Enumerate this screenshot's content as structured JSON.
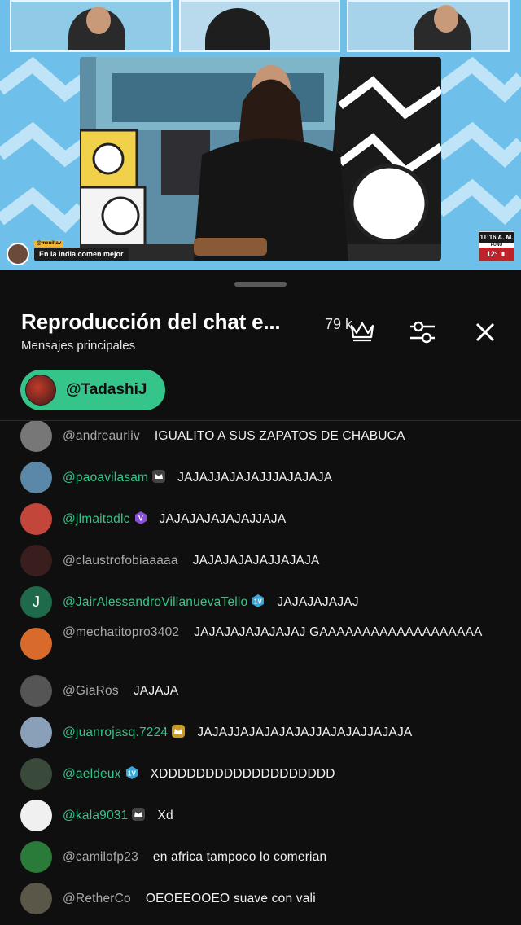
{
  "video": {
    "caption_handle": "@meniltav",
    "caption_text": "En la India comen mejor",
    "clock_time": "11:16 A. M.",
    "clock_city": "PUNO",
    "clock_temp": "12°"
  },
  "chat": {
    "title": "Reproducción del chat e...",
    "subtitle": "Mensajes principales",
    "viewers": "79 k",
    "pinned_user": "@TadashiJ",
    "messages": [
      {
        "author": "@andreaurliv",
        "text": "IGUALITO A SUS ZAPATOS DE CHABUCA",
        "green": false,
        "badge": "",
        "avatar_color": "#777777"
      },
      {
        "author": "@paoavilasam",
        "text": "JAJAJJAJAJAJJJAJAJAJA",
        "green": true,
        "badge": "crown-badge",
        "avatar_color": "#5b87a8"
      },
      {
        "author": "@jlmaitadlc",
        "text": "JAJAJAJAJAJAJJAJA",
        "green": true,
        "badge": "member-badge-purple",
        "avatar_color": "#c2473a"
      },
      {
        "author": "@claustrofobiaaaaa",
        "text": "JAJAJAJAJAJJAJAJA",
        "green": false,
        "badge": "",
        "avatar_color": "#3a1e1e"
      },
      {
        "author": "@JairAlessandroVillanuevaTello",
        "text": "JAJAJAJAJAJ",
        "green": true,
        "badge": "member-badge-1v",
        "avatar_color": "#1f6a4a",
        "initial": "J"
      },
      {
        "author": "@mechatitopro3402",
        "text": "JAJAJAJAJAJAJAJ GAAAAAAAAAAAAAAAAAAA",
        "green": false,
        "badge": "",
        "avatar_color": "#d86a2b"
      },
      {
        "author": "@GiaRos",
        "text": "JAJAJA",
        "green": false,
        "badge": "",
        "avatar_color": "#555555"
      },
      {
        "author": "@juanrojasq.7224",
        "text": "JAJAJJAJAJAJAJAJJAJAJAJJAJAJA",
        "green": true,
        "badge": "crown-badge-gold",
        "avatar_color": "#8aa0b8"
      },
      {
        "author": "@aeldeux",
        "text": "XDDDDDDDDDDDDDDDDDDD",
        "green": true,
        "badge": "member-badge-1v",
        "avatar_color": "#3a4a3a"
      },
      {
        "author": "@kala9031",
        "text": "Xd",
        "green": true,
        "badge": "crown-badge",
        "avatar_color": "#f0f0f0"
      },
      {
        "author": "@camilofp23",
        "text": "en africa tampoco lo comerian",
        "green": false,
        "badge": "",
        "avatar_color": "#2a7a3a"
      },
      {
        "author": "@RetherCo",
        "text": "OEOEEOOEO suave con vali",
        "green": false,
        "badge": "",
        "avatar_color": "#5a5648"
      }
    ]
  }
}
